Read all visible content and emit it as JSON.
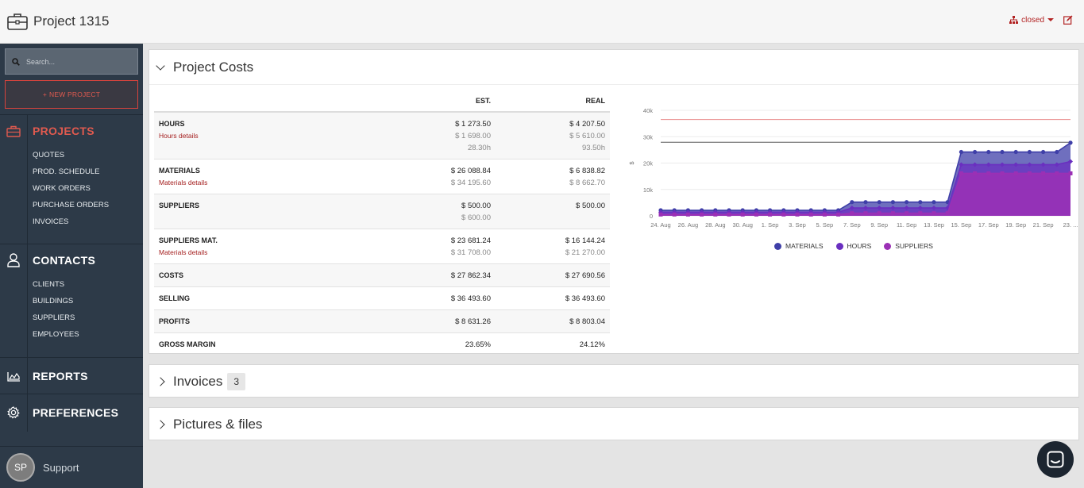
{
  "header": {
    "title": "Project 1315",
    "status": "closed"
  },
  "sidebar": {
    "search_placeholder": "Search...",
    "new_project": "NEW PROJECT",
    "sections": {
      "projects": {
        "label": "PROJECTS",
        "items": [
          "QUOTES",
          "PROD. SCHEDULE",
          "WORK ORDERS",
          "PURCHASE ORDERS",
          "INVOICES"
        ]
      },
      "contacts": {
        "label": "CONTACTS",
        "items": [
          "CLIENTS",
          "BUILDINGS",
          "SUPPLIERS",
          "EMPLOYEES"
        ]
      },
      "reports": {
        "label": "REPORTS"
      },
      "preferences": {
        "label": "PREFERENCES"
      }
    },
    "support": {
      "initials": "SP",
      "name": "Support"
    }
  },
  "costs_panel": {
    "title": "Project Costs",
    "columns": {
      "est": "EST.",
      "real": "REAL"
    },
    "rows": {
      "hours": {
        "name": "HOURS",
        "detail": "Hours details",
        "est": "$ 1 273.50",
        "real": "$ 4 207.50",
        "est2": "$ 1 698.00",
        "real2": "$ 5 610.00",
        "est3": "28.30h",
        "real3": "93.50h"
      },
      "materials": {
        "name": "MATERIALS",
        "detail": "Materials details",
        "est": "$ 26 088.84",
        "real": "$ 6 838.82",
        "est2": "$ 34 195.60",
        "real2": "$ 8 662.70"
      },
      "suppliers": {
        "name": "SUPPLIERS",
        "est": "$ 500.00",
        "real": "$ 500.00",
        "est2": "$ 600.00"
      },
      "suppliers_mat": {
        "name": "SUPPLIERS MAT.",
        "detail": "Materials details",
        "est": "$ 23 681.24",
        "real": "$ 16 144.24",
        "est2": "$ 31 708.00",
        "real2": "$ 21 270.00"
      },
      "costs": {
        "name": "COSTS",
        "est": "$ 27 862.34",
        "real": "$ 27 690.56"
      },
      "selling": {
        "name": "SELLING",
        "est": "$ 36 493.60",
        "real": "$ 36 493.60"
      },
      "profits": {
        "name": "PROFITS",
        "est": "$ 8 631.26",
        "real": "$ 8 803.04"
      },
      "gross_margin": {
        "name": "GROSS MARGIN",
        "est": "23.65%",
        "real": "24.12%"
      }
    }
  },
  "chart_data": {
    "type": "area",
    "ylabel": "$",
    "ylim": [
      0,
      40000
    ],
    "yticks": [
      "0",
      "10k",
      "20k",
      "30k",
      "40k"
    ],
    "xticks": [
      "24. Aug",
      "26. Aug",
      "28. Aug",
      "30. Aug",
      "1. Sep",
      "3. Sep",
      "5. Sep",
      "7. Sep",
      "9. Sep",
      "11. Sep",
      "13. Sep",
      "15. Sep",
      "17. Sep",
      "19. Sep",
      "21. Sep",
      "23. ..."
    ],
    "x_count": 31,
    "reference_lines": [
      {
        "value": 36500,
        "color": "#e88a8a"
      },
      {
        "value": 27900,
        "color": "#555555"
      }
    ],
    "series": [
      {
        "name": "MATERIALS",
        "color": "#3f3fa8",
        "values": [
          2100,
          2100,
          2100,
          2100,
          2100,
          2100,
          2100,
          2100,
          2100,
          2100,
          2100,
          2100,
          2100,
          2100,
          5200,
          5200,
          5200,
          5200,
          5200,
          5200,
          5200,
          5200,
          24200,
          24200,
          24200,
          24200,
          24200,
          24200,
          24200,
          24200,
          27700
        ]
      },
      {
        "name": "HOURS",
        "color": "#6a2fc0",
        "values": [
          1400,
          1400,
          1400,
          1400,
          1400,
          1400,
          1400,
          1400,
          1400,
          1400,
          1400,
          1400,
          1400,
          1400,
          3000,
          3000,
          3000,
          3000,
          3000,
          3000,
          3000,
          3000,
          19400,
          19400,
          19400,
          19400,
          19400,
          19400,
          19400,
          19400,
          20600
        ]
      },
      {
        "name": "SUPPLIERS",
        "color": "#9b30b5",
        "values": [
          500,
          500,
          500,
          500,
          500,
          500,
          500,
          500,
          500,
          500,
          500,
          500,
          500,
          500,
          1000,
          1000,
          1000,
          1000,
          1000,
          1000,
          1000,
          1000,
          16100,
          16100,
          16100,
          16100,
          16100,
          16100,
          16100,
          16100,
          16100
        ]
      }
    ],
    "legend_position": "bottom-center"
  },
  "invoices_panel": {
    "title": "Invoices",
    "count": "3"
  },
  "files_panel": {
    "title": "Pictures & files"
  }
}
